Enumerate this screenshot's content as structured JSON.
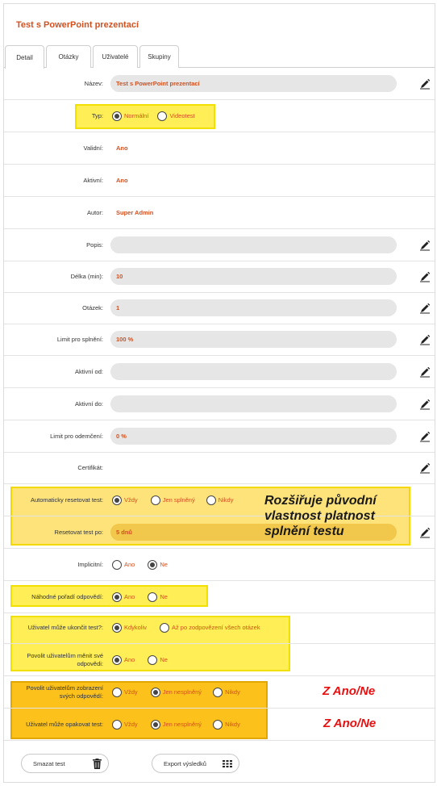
{
  "title": "Test s PowerPoint prezentací",
  "tabs": [
    "Detail",
    "Otázky",
    "Uživatelé",
    "Skupiny"
  ],
  "fields": {
    "nazev": {
      "label": "Název:",
      "value": "Test s PowerPoint prezentací"
    },
    "typ": {
      "label": "Typ:",
      "options": [
        "Normální",
        "Videotest"
      ],
      "selected": "Normální"
    },
    "validni": {
      "label": "Validní:",
      "value": "Ano"
    },
    "aktivni": {
      "label": "Aktivní:",
      "value": "Ano"
    },
    "autor": {
      "label": "Autor:",
      "value": "Super Admin"
    },
    "popis": {
      "label": "Popis:",
      "value": ""
    },
    "delka": {
      "label": "Délka (min):",
      "value": "10"
    },
    "otazek": {
      "label": "Otázek:",
      "value": "1"
    },
    "limit_splneni": {
      "label": "Limit pro splnění:",
      "value": "100 %"
    },
    "aktivni_od": {
      "label": "Aktivní od:",
      "value": ""
    },
    "aktivni_do": {
      "label": "Aktivní do:",
      "value": ""
    },
    "limit_odemceni": {
      "label": "Limit pro odemčení:",
      "value": "0 %"
    },
    "certifikat": {
      "label": "Certifikát:"
    },
    "auto_reset": {
      "label": "Automaticky resetovat test:",
      "options": [
        "Vždy",
        "Jen splněný",
        "Nikdy"
      ],
      "selected": "Vždy"
    },
    "reset_po": {
      "label": "Resetovat test po:",
      "value": "5 dnů"
    },
    "implicitni": {
      "label": "Implicitní:",
      "options": [
        "Ano",
        "Ne"
      ],
      "selected": "Ne"
    },
    "nahodne": {
      "label": "Náhodné pořadí odpovědí:",
      "options": [
        "Ano",
        "Ne"
      ],
      "selected": "Ano"
    },
    "ukoncit": {
      "label": "Uživatel může ukončit test?:",
      "options": [
        "Kdykoliv",
        "Až po zodpovězení všech otázek"
      ],
      "selected": "Kdykoliv"
    },
    "menit": {
      "label_1": "Povolit uživatelům měnit své",
      "label_2": "odpovědi:",
      "options": [
        "Ano",
        "Ne"
      ],
      "selected": "Ano"
    },
    "zobrazeni": {
      "label_1": "Povolit uživatelům zobrazení",
      "label_2": "svých odpovědí:",
      "options": [
        "Vždy",
        "Jen nesplněný",
        "Nikdy"
      ],
      "selected": "Jen nesplněný"
    },
    "opakovat": {
      "label": "Uživatel může opakovat test:",
      "options": [
        "Vždy",
        "Jen nesplněný",
        "Nikdy"
      ],
      "selected": "Jen nesplněný"
    }
  },
  "annotations": {
    "expand_note_1": "Rozšiřuje původní",
    "expand_note_2": "vlastnost platnost",
    "expand_note_3": "splnění testu",
    "zano_1": "Z Ano/Ne",
    "zano_2": "Z Ano/Ne"
  },
  "buttons": {
    "delete": "Smazat test",
    "export": "Export výsledků"
  },
  "icons": {
    "edit": "pencil-icon",
    "delete": "trash-icon",
    "export": "grid-icon"
  },
  "colors": {
    "accent": "#d4501e",
    "field_bg": "#e6e6e6",
    "highlight": "#fde37a",
    "highlight_dark": "#fcc21b",
    "annotation_red": "#e81010"
  }
}
